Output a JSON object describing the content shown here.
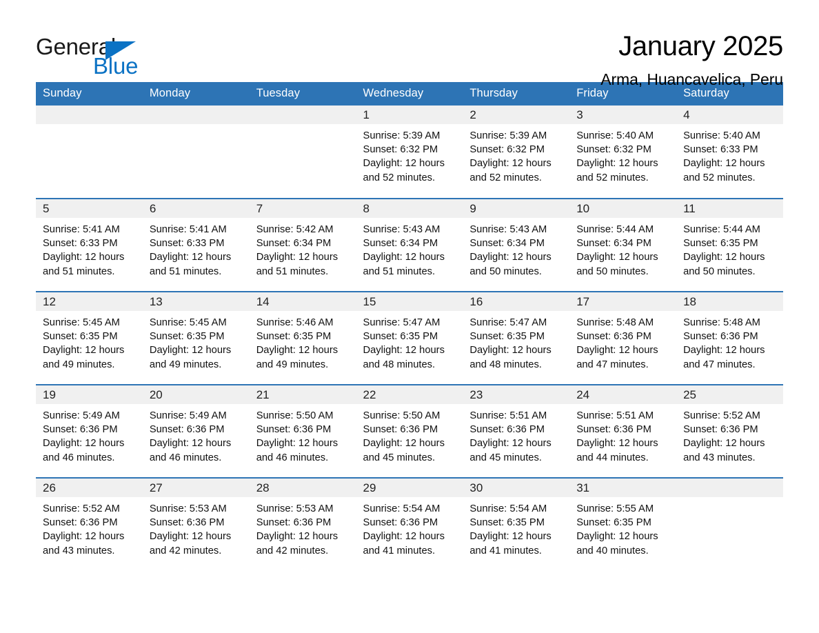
{
  "logo": {
    "word_general": "General",
    "word_blue": "Blue",
    "triangle_color": "#0b72c4"
  },
  "header": {
    "title": "January 2025",
    "subtitle": "Arma, Huancavelica, Peru"
  },
  "theme": {
    "header_blue": "#2d74b5",
    "daynum_band": "#f0f0f0",
    "text": "#111111"
  },
  "weekday_headers": [
    "Sunday",
    "Monday",
    "Tuesday",
    "Wednesday",
    "Thursday",
    "Friday",
    "Saturday"
  ],
  "weeks": [
    [
      {
        "day": "",
        "empty": true
      },
      {
        "day": "",
        "empty": true
      },
      {
        "day": "",
        "empty": true
      },
      {
        "day": "1",
        "sunrise": "Sunrise: 5:39 AM",
        "sunset": "Sunset: 6:32 PM",
        "daylight": "Daylight: 12 hours and 52 minutes."
      },
      {
        "day": "2",
        "sunrise": "Sunrise: 5:39 AM",
        "sunset": "Sunset: 6:32 PM",
        "daylight": "Daylight: 12 hours and 52 minutes."
      },
      {
        "day": "3",
        "sunrise": "Sunrise: 5:40 AM",
        "sunset": "Sunset: 6:32 PM",
        "daylight": "Daylight: 12 hours and 52 minutes."
      },
      {
        "day": "4",
        "sunrise": "Sunrise: 5:40 AM",
        "sunset": "Sunset: 6:33 PM",
        "daylight": "Daylight: 12 hours and 52 minutes."
      }
    ],
    [
      {
        "day": "5",
        "sunrise": "Sunrise: 5:41 AM",
        "sunset": "Sunset: 6:33 PM",
        "daylight": "Daylight: 12 hours and 51 minutes."
      },
      {
        "day": "6",
        "sunrise": "Sunrise: 5:41 AM",
        "sunset": "Sunset: 6:33 PM",
        "daylight": "Daylight: 12 hours and 51 minutes."
      },
      {
        "day": "7",
        "sunrise": "Sunrise: 5:42 AM",
        "sunset": "Sunset: 6:34 PM",
        "daylight": "Daylight: 12 hours and 51 minutes."
      },
      {
        "day": "8",
        "sunrise": "Sunrise: 5:43 AM",
        "sunset": "Sunset: 6:34 PM",
        "daylight": "Daylight: 12 hours and 51 minutes."
      },
      {
        "day": "9",
        "sunrise": "Sunrise: 5:43 AM",
        "sunset": "Sunset: 6:34 PM",
        "daylight": "Daylight: 12 hours and 50 minutes."
      },
      {
        "day": "10",
        "sunrise": "Sunrise: 5:44 AM",
        "sunset": "Sunset: 6:34 PM",
        "daylight": "Daylight: 12 hours and 50 minutes."
      },
      {
        "day": "11",
        "sunrise": "Sunrise: 5:44 AM",
        "sunset": "Sunset: 6:35 PM",
        "daylight": "Daylight: 12 hours and 50 minutes."
      }
    ],
    [
      {
        "day": "12",
        "sunrise": "Sunrise: 5:45 AM",
        "sunset": "Sunset: 6:35 PM",
        "daylight": "Daylight: 12 hours and 49 minutes."
      },
      {
        "day": "13",
        "sunrise": "Sunrise: 5:45 AM",
        "sunset": "Sunset: 6:35 PM",
        "daylight": "Daylight: 12 hours and 49 minutes."
      },
      {
        "day": "14",
        "sunrise": "Sunrise: 5:46 AM",
        "sunset": "Sunset: 6:35 PM",
        "daylight": "Daylight: 12 hours and 49 minutes."
      },
      {
        "day": "15",
        "sunrise": "Sunrise: 5:47 AM",
        "sunset": "Sunset: 6:35 PM",
        "daylight": "Daylight: 12 hours and 48 minutes."
      },
      {
        "day": "16",
        "sunrise": "Sunrise: 5:47 AM",
        "sunset": "Sunset: 6:35 PM",
        "daylight": "Daylight: 12 hours and 48 minutes."
      },
      {
        "day": "17",
        "sunrise": "Sunrise: 5:48 AM",
        "sunset": "Sunset: 6:36 PM",
        "daylight": "Daylight: 12 hours and 47 minutes."
      },
      {
        "day": "18",
        "sunrise": "Sunrise: 5:48 AM",
        "sunset": "Sunset: 6:36 PM",
        "daylight": "Daylight: 12 hours and 47 minutes."
      }
    ],
    [
      {
        "day": "19",
        "sunrise": "Sunrise: 5:49 AM",
        "sunset": "Sunset: 6:36 PM",
        "daylight": "Daylight: 12 hours and 46 minutes."
      },
      {
        "day": "20",
        "sunrise": "Sunrise: 5:49 AM",
        "sunset": "Sunset: 6:36 PM",
        "daylight": "Daylight: 12 hours and 46 minutes."
      },
      {
        "day": "21",
        "sunrise": "Sunrise: 5:50 AM",
        "sunset": "Sunset: 6:36 PM",
        "daylight": "Daylight: 12 hours and 46 minutes."
      },
      {
        "day": "22",
        "sunrise": "Sunrise: 5:50 AM",
        "sunset": "Sunset: 6:36 PM",
        "daylight": "Daylight: 12 hours and 45 minutes."
      },
      {
        "day": "23",
        "sunrise": "Sunrise: 5:51 AM",
        "sunset": "Sunset: 6:36 PM",
        "daylight": "Daylight: 12 hours and 45 minutes."
      },
      {
        "day": "24",
        "sunrise": "Sunrise: 5:51 AM",
        "sunset": "Sunset: 6:36 PM",
        "daylight": "Daylight: 12 hours and 44 minutes."
      },
      {
        "day": "25",
        "sunrise": "Sunrise: 5:52 AM",
        "sunset": "Sunset: 6:36 PM",
        "daylight": "Daylight: 12 hours and 43 minutes."
      }
    ],
    [
      {
        "day": "26",
        "sunrise": "Sunrise: 5:52 AM",
        "sunset": "Sunset: 6:36 PM",
        "daylight": "Daylight: 12 hours and 43 minutes."
      },
      {
        "day": "27",
        "sunrise": "Sunrise: 5:53 AM",
        "sunset": "Sunset: 6:36 PM",
        "daylight": "Daylight: 12 hours and 42 minutes."
      },
      {
        "day": "28",
        "sunrise": "Sunrise: 5:53 AM",
        "sunset": "Sunset: 6:36 PM",
        "daylight": "Daylight: 12 hours and 42 minutes."
      },
      {
        "day": "29",
        "sunrise": "Sunrise: 5:54 AM",
        "sunset": "Sunset: 6:36 PM",
        "daylight": "Daylight: 12 hours and 41 minutes."
      },
      {
        "day": "30",
        "sunrise": "Sunrise: 5:54 AM",
        "sunset": "Sunset: 6:35 PM",
        "daylight": "Daylight: 12 hours and 41 minutes."
      },
      {
        "day": "31",
        "sunrise": "Sunrise: 5:55 AM",
        "sunset": "Sunset: 6:35 PM",
        "daylight": "Daylight: 12 hours and 40 minutes."
      },
      {
        "day": "",
        "empty": true
      }
    ]
  ]
}
